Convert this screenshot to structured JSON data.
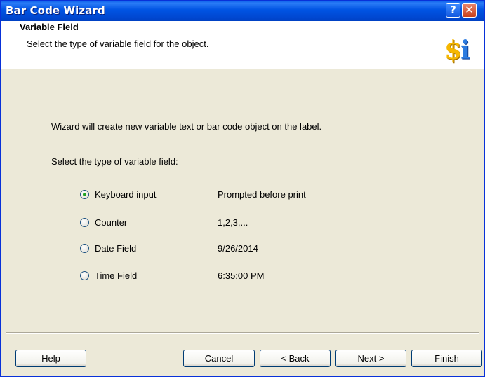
{
  "window": {
    "title": "Bar Code Wizard"
  },
  "titlebar": {
    "help": "?",
    "close": "✕"
  },
  "header": {
    "title": "Variable Field",
    "subtitle": "Select the type of variable field for the object.",
    "logo": [
      "$",
      "i"
    ]
  },
  "body": {
    "intro": "Wizard will create new variable text or bar code object on the label.",
    "select_label": "Select the type of variable field:",
    "options": [
      {
        "label": "Keyboard input",
        "value": "Prompted before print",
        "checked": true
      },
      {
        "label": "Counter",
        "value": "1,2,3,...",
        "checked": false
      },
      {
        "label": "Date Field",
        "value": "9/26/2014",
        "checked": false
      },
      {
        "label": "Time Field",
        "value": "6:35:00 PM",
        "checked": false
      }
    ]
  },
  "buttons": {
    "help": "Help",
    "cancel": "Cancel",
    "back": "< Back",
    "next": "Next >",
    "finish": "Finish"
  }
}
